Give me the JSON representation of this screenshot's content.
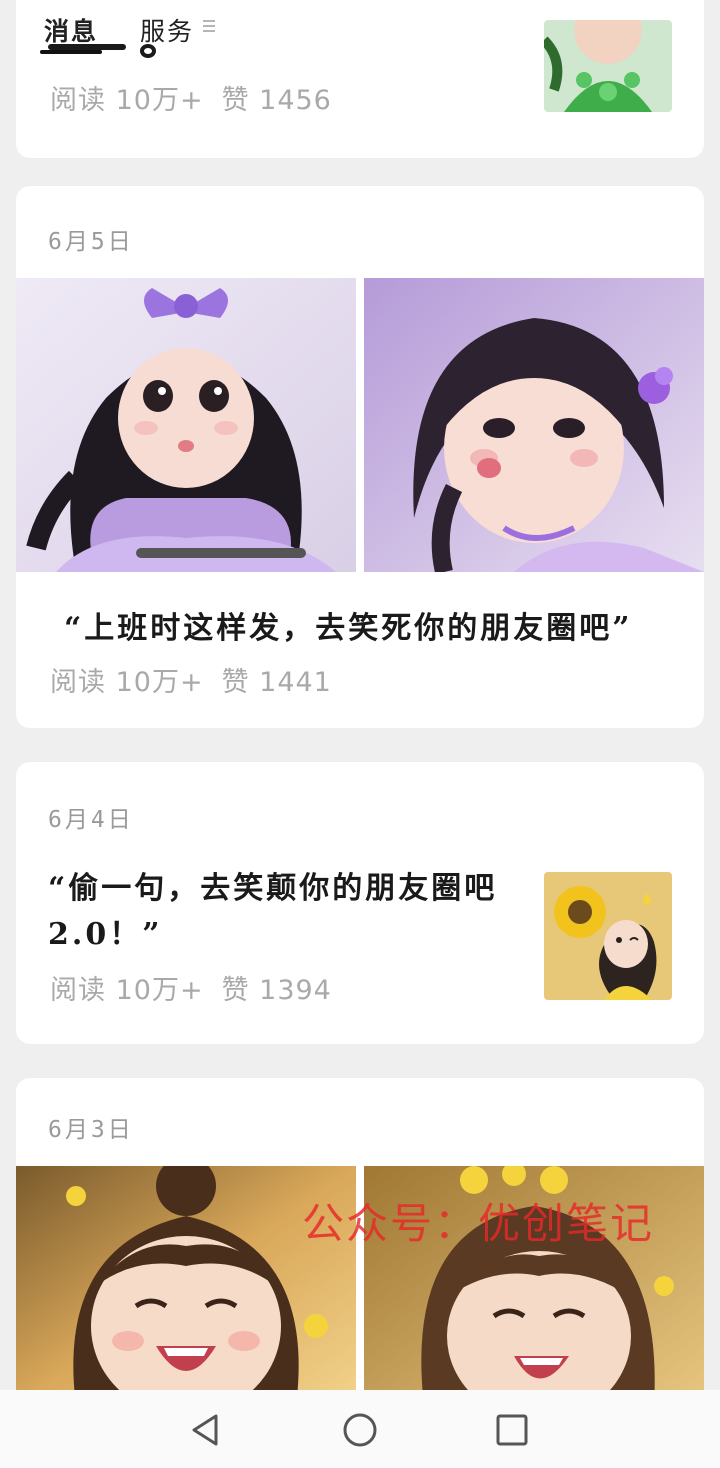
{
  "tabs": [
    {
      "label": "消息",
      "active": true
    },
    {
      "label": "服务",
      "active": false
    }
  ],
  "articles": [
    {
      "date": "",
      "title": "",
      "reads": "阅读 10万+",
      "likes": "赞 1456",
      "layout": "thumbnail",
      "image": "girl-green-dress"
    },
    {
      "date": "6月5日",
      "title": "“上班时这样发，去笑死你的朋友圈吧”",
      "reads": "阅读 10万+",
      "likes": "赞 1441",
      "layout": "two-images",
      "images": [
        "girl-purple-bow-motorbike",
        "girl-purple-pigtails-kiss"
      ]
    },
    {
      "date": "6月4日",
      "title_line1": "“偷一句，去笑颠你的朋友圈吧",
      "title_line2": "2.0！”",
      "reads": "阅读 10万+",
      "likes": "赞 1394",
      "layout": "thumbnail",
      "image": "girl-sunflower"
    },
    {
      "date": "6月3日",
      "layout": "two-images",
      "images": [
        "girl-laughing-bun",
        "girl-laughing-yellow-flowers"
      ]
    }
  ],
  "watermark": "公众号：优创笔记",
  "nav": {
    "back": "back-icon",
    "home": "home-icon",
    "recents": "recents-icon"
  },
  "colors": {
    "background": "#efefef",
    "card": "#ffffff",
    "meta_text": "#a9a9a9",
    "watermark": "#e62828"
  }
}
